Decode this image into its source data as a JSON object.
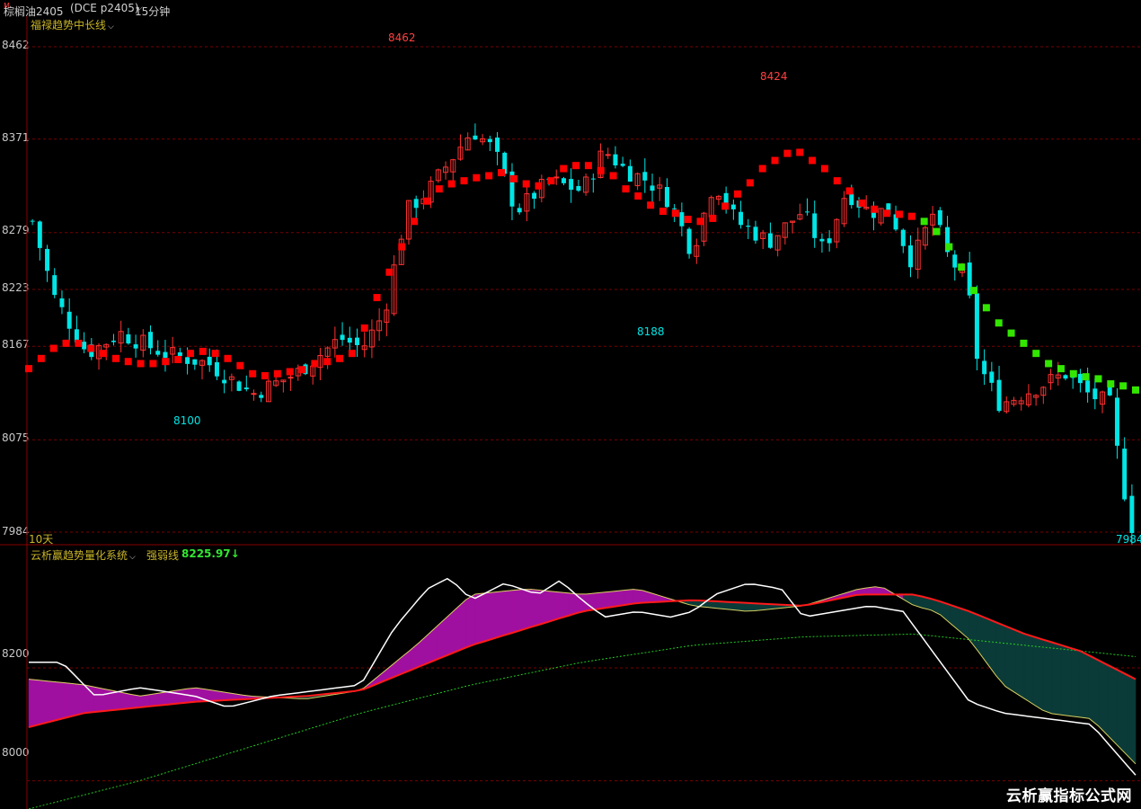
{
  "header": {
    "symbol": "棕榈油2405",
    "symbol_mark": "M",
    "code": "(DCE p2405)",
    "period": "15分钟"
  },
  "main_panel": {
    "indicator_name": "福禄趋势中长线",
    "y_ticks": [
      "8462",
      "8371",
      "8279",
      "8223",
      "8167",
      "8075",
      "7984"
    ],
    "annotations": {
      "high1": "8462",
      "high2": "8424",
      "low1": "8100",
      "low2": "8188",
      "last": "7984"
    },
    "days_label": "10天"
  },
  "sub_panel": {
    "indicator_name": "云析赢趋势量化系统",
    "value_label": "强弱线",
    "value": "8225.97↓",
    "y_ticks": [
      "8200",
      "8000"
    ]
  },
  "watermark": "云析赢指标公式网",
  "colors": {
    "up": "#ff3030",
    "down": "#00e5e5",
    "trend_up": "#ff0000",
    "trend_down": "#33e600",
    "magenta_fill": "#a010a0",
    "teal_fill": "#0b3b38",
    "grid": "#7a0000"
  },
  "chart_data": [
    {
      "type": "candlestick",
      "ylim": [
        7984,
        8462
      ],
      "y_ticks": [
        8462,
        8371,
        8279,
        8223,
        8167,
        8075,
        7984
      ],
      "grid": true,
      "series": [
        {
          "name": "福禄趋势中长线",
          "values": [
            8145,
            8155,
            8165,
            8170,
            8170,
            8165,
            8160,
            8155,
            8152,
            8150,
            8150,
            8152,
            8154,
            8160,
            8162,
            8160,
            8155,
            8148,
            8140,
            8138,
            8140,
            8142,
            8144,
            8150,
            8152,
            8155,
            8160,
            8185,
            8215,
            8240,
            8265,
            8290,
            8310,
            8322,
            8327,
            8330,
            8333,
            8335,
            8338,
            8332,
            8327,
            8325,
            8330,
            8342,
            8345,
            8345,
            8340,
            8335,
            8322,
            8315,
            8306,
            8300,
            8298,
            8292,
            8290,
            8293,
            8305,
            8317,
            8328,
            8342,
            8350,
            8357,
            8358,
            8350,
            8342,
            8330,
            8320,
            8308,
            8302,
            8298,
            8297,
            8295,
            8290,
            8280,
            8265,
            8245,
            8222,
            8205,
            8190,
            8180,
            8170,
            8160,
            8150,
            8145,
            8140,
            8137,
            8135,
            8130,
            8128,
            8124
          ]
        }
      ]
    },
    {
      "type": "area",
      "ylim": [
        7950,
        8380
      ],
      "y_ticks": [
        8200,
        8000
      ],
      "series": [
        {
          "name": "强弱线",
          "values": [
            8225.97
          ]
        }
      ]
    }
  ]
}
